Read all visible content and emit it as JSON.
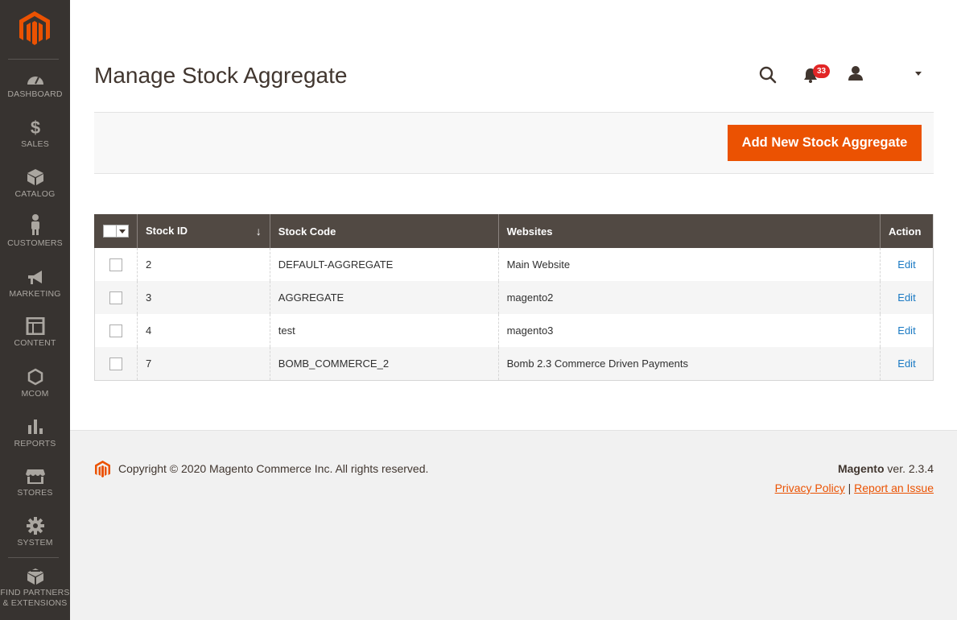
{
  "sidebar": {
    "logo_icon": "magento-logo-icon",
    "items": [
      {
        "label": "DASHBOARD",
        "icon": "dashboard-icon"
      },
      {
        "label": "SALES",
        "icon": "dollar-icon"
      },
      {
        "label": "CATALOG",
        "icon": "box-icon"
      },
      {
        "label": "CUSTOMERS",
        "icon": "person-icon"
      },
      {
        "label": "MARKETING",
        "icon": "megaphone-icon"
      },
      {
        "label": "CONTENT",
        "icon": "layout-icon"
      },
      {
        "label": "MCOM",
        "icon": "hexagon-icon"
      },
      {
        "label": "REPORTS",
        "icon": "bar-chart-icon"
      },
      {
        "label": "STORES",
        "icon": "store-icon"
      },
      {
        "label": "SYSTEM",
        "icon": "gear-icon"
      },
      {
        "label_line1": "FIND PARTNERS",
        "label_line2": "& EXTENSIONS",
        "icon": "partners-icon"
      }
    ]
  },
  "header": {
    "title": "Manage Stock Aggregate",
    "notifications_count": "33"
  },
  "actions": {
    "add_label": "Add New Stock Aggregate"
  },
  "grid": {
    "columns": {
      "stock_id": "Stock ID",
      "stock_code": "Stock Code",
      "websites": "Websites",
      "action": "Action"
    },
    "sort_indicator": "↓",
    "rows": [
      {
        "id": "2",
        "code": "DEFAULT-AGGREGATE",
        "websites": "Main Website",
        "action": "Edit"
      },
      {
        "id": "3",
        "code": "AGGREGATE",
        "websites": "magento2",
        "action": "Edit"
      },
      {
        "id": "4",
        "code": "test",
        "websites": "magento3",
        "action": "Edit"
      },
      {
        "id": "7",
        "code": "BOMB_COMMERCE_2",
        "websites": "Bomb 2.3 Commerce Driven Payments",
        "action": "Edit"
      }
    ]
  },
  "footer": {
    "copyright": "Copyright © 2020 Magento Commerce Inc. All rights reserved.",
    "brand": "Magento",
    "version": " ver. 2.3.4",
    "privacy": "Privacy Policy",
    "separator": " | ",
    "report": "Report an Issue"
  },
  "colors": {
    "accent": "#eb5202",
    "sidebar_bg": "#373330",
    "grid_header_bg": "#514943",
    "link": "#1979c3"
  }
}
